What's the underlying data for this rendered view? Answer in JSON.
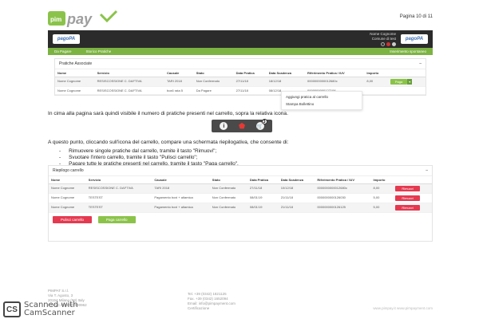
{
  "header": {
    "logo_text": "PAY",
    "logo_prefix": "pim",
    "page_number": "Pagina 10 di 11"
  },
  "app": {
    "logo_left": "pagoPA",
    "logo_right": "pagoPA",
    "user_name": "Nome Cognome",
    "user_entity": "Comune di test",
    "nav": [
      "Da Pagare",
      "Storico Pratiche"
    ],
    "nav_right": "Inserimento spontaneo",
    "pratiche_title": "Pratiche Associate",
    "pratiche_headers": [
      "Nome",
      "Servizio",
      "Causale",
      "Stato",
      "Data Pratica",
      "Data Scadenza",
      "Riferimento Pratica / IUV",
      "Importo"
    ],
    "pratiche_rows": [
      [
        "Nome Cognome",
        "RESISCOSSIONE C. DAFTIVA",
        "TARI 2018",
        "Non Confermato",
        "27/11/18",
        "18/12/18",
        "0000000000012680c",
        "8,00"
      ],
      [
        "Nome Cognome",
        "RESISCOSSIONE C. DAFTIVA",
        "box6 rata 5",
        "Da Pagare",
        "27/11/18",
        "08/12/18",
        "0000000000127106",
        ""
      ]
    ],
    "paga_label": "Paga",
    "dropdown": [
      "Aggiungi pratica al carrello",
      "Stampa Bollettino"
    ]
  },
  "text": {
    "p1": "In cima alla pagina sarà quindi visibile il numero di pratiche presenti nel carrello, sopra la relativa icona.",
    "p2": "A questo punto, cliccando sull'icona del carrello, compare una schermata riepilogativa, che consente di:",
    "bullets": [
      "Rimuovere singole pratiche dal carrello, tramite il tasto \"Rimuovi\";",
      "Svuotare l'intero carrello, tramite il tasto \"Pulisci carrello\";",
      "Pagare tutte le pratiche presenti nel carrello, tramite il tasto \"Paga carrello\"."
    ]
  },
  "icons_row": {
    "items": [
      "info-icon",
      "pdf-icon",
      "cart-icon"
    ],
    "cart_count": "3"
  },
  "riepilogo": {
    "title": "Riepilogo carrello",
    "headers": [
      "Nome",
      "Servizio",
      "Causale",
      "Stato",
      "Data Pratica",
      "Data Scadenza",
      "Riferimento Pratica / IUV",
      "Importo",
      ""
    ],
    "rows": [
      [
        "Nome Cognome",
        "RESISCOSSIONE C. DAFTIVA",
        "TARI 2018",
        "Non Confermato",
        "27/11/18",
        "10/12/18",
        "0000000000012680c",
        "8,00"
      ],
      [
        "Nome Cognome",
        "TESTEST",
        "Pagamento boxi + altamica",
        "Non Confermato",
        "08/01/19",
        "21/11/18",
        "0000000000126030",
        "5,00"
      ],
      [
        "Nome Cognome",
        "TESTEST",
        "Pagamento boxi + altamica",
        "Non Confermato",
        "08/01/19",
        "21/11/18",
        "0000000000126125",
        "5,00"
      ]
    ],
    "rimuovi_label": "Rimuovi",
    "pulisci_label": "Pulisci carrello",
    "paga_carrello_label": "Paga carrello"
  },
  "footer": {
    "company": "PIMPAT S.r.l.",
    "addr1": "Via T. Agosto, 3",
    "addr2": "20154 Milano (MI) Italy",
    "addr3": "P.IVA/C.F. 08787000962",
    "tel": "Tel. +39 (0342) 1821125",
    "fax": "Fax. +39 (0342) 1652094",
    "email": "Email: info@pimpayment.com",
    "cert": "Certificazione",
    "site": "www.pimpay.it  www.pimpayment.com"
  },
  "scanner": {
    "badge": "CS",
    "line1": "Scanned with",
    "line2": "CamScanner"
  },
  "colors": {
    "green": "#7cb342",
    "red": "#e53950",
    "dark": "#2b2b2b"
  }
}
